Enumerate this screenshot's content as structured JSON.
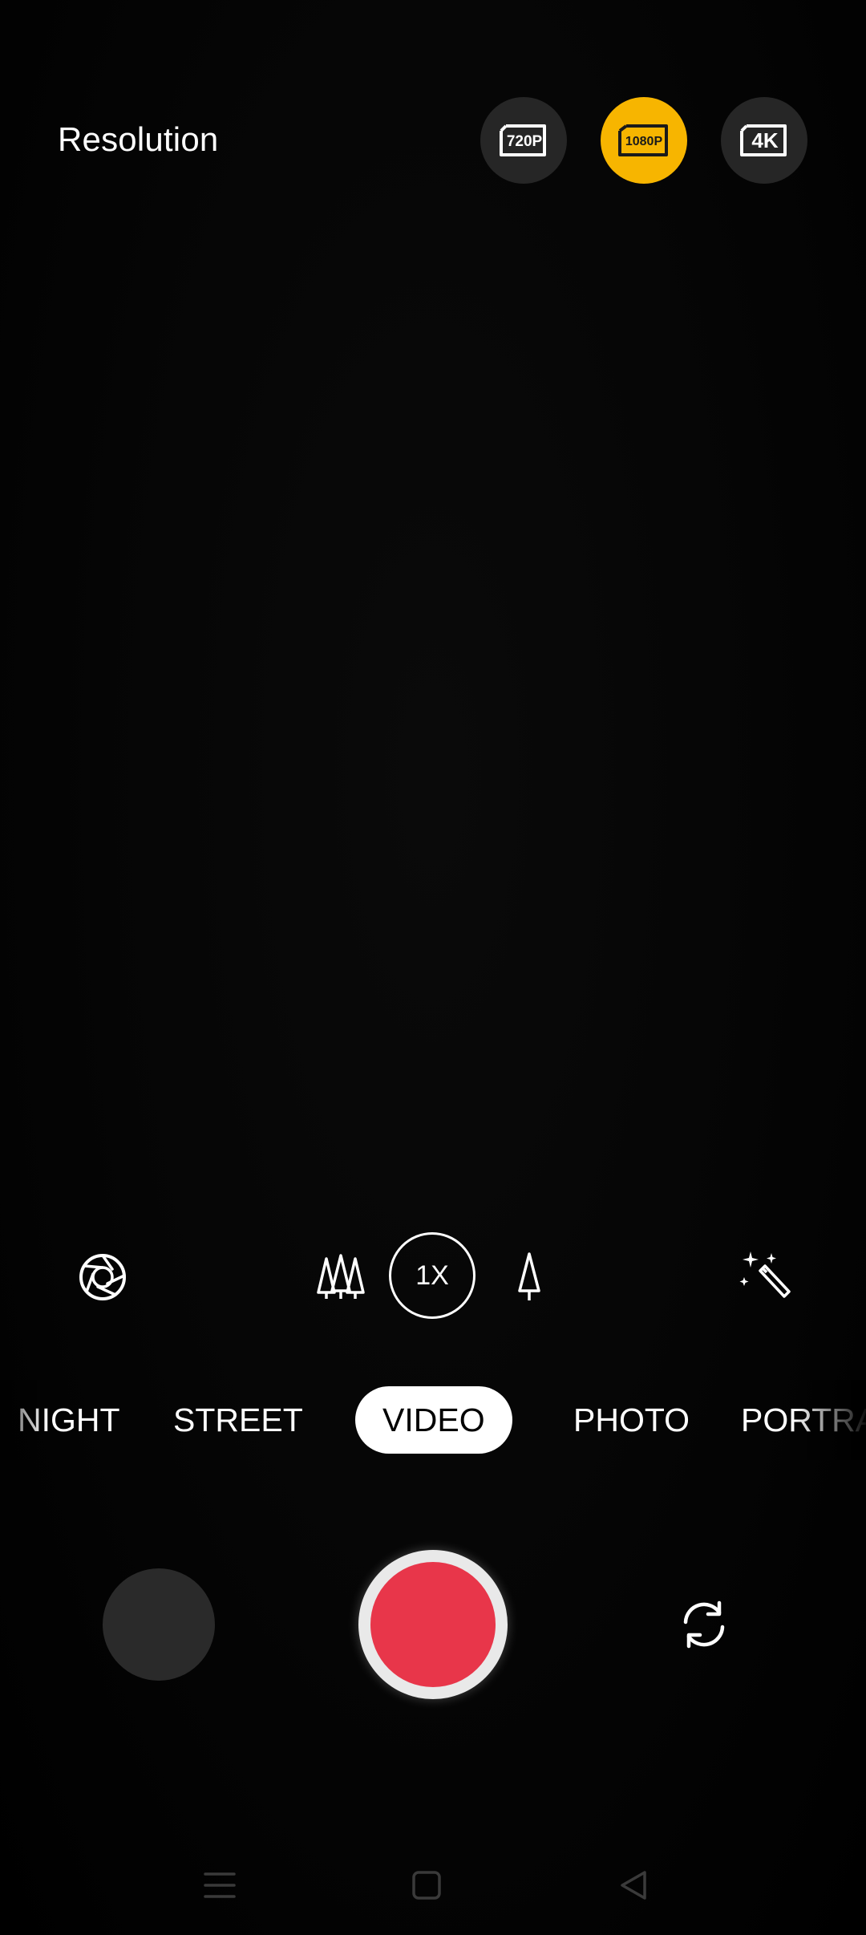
{
  "resolution": {
    "label": "Resolution",
    "options": [
      {
        "label": "720P",
        "selected": false
      },
      {
        "label": "1080P",
        "selected": true
      },
      {
        "label": "4K",
        "selected": false
      }
    ],
    "accent_color": "#f7b500"
  },
  "tools": {
    "left_icon": "aperture-icon",
    "wide_icon": "trees-wide-icon",
    "zoom_label": "1X",
    "tele_icon": "tree-tele-icon",
    "right_icon": "magic-wand-icon"
  },
  "modes": {
    "items": [
      "NIGHT",
      "STREET",
      "VIDEO",
      "PHOTO",
      "PORTRAIT"
    ],
    "active": "VIDEO"
  },
  "controls": {
    "gallery": "gallery-thumbnail",
    "shutter": "record-button",
    "shutter_color": "#e8364a",
    "flip_icon": "switch-camera-icon"
  },
  "navbar": {
    "items": [
      "menu-icon",
      "home-icon",
      "back-icon"
    ]
  }
}
